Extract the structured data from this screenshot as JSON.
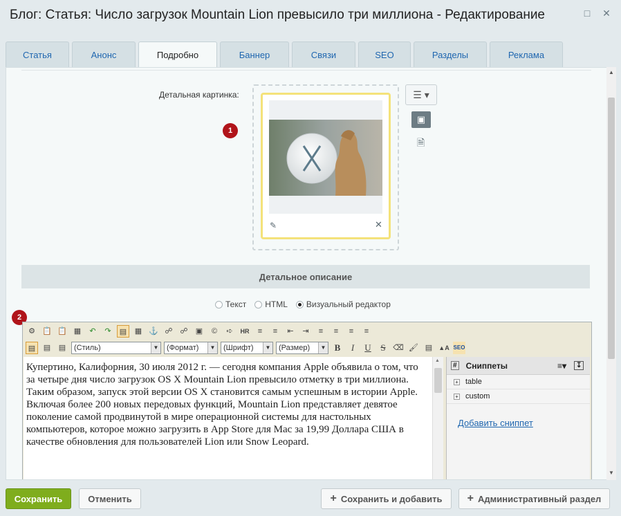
{
  "window": {
    "title": "Блог: Статья: Число загрузок Mountain Lion превысило три миллиона - Редактирование"
  },
  "tabs": [
    {
      "label": "Статья"
    },
    {
      "label": "Анонс"
    },
    {
      "label": "Подробно"
    },
    {
      "label": "Баннер"
    },
    {
      "label": "Связи"
    },
    {
      "label": "SEO"
    },
    {
      "label": "Разделы"
    },
    {
      "label": "Реклама"
    }
  ],
  "detail_image": {
    "label": "Детальная картинка:",
    "badge": "1"
  },
  "detail_description": {
    "heading": "Детальное описание",
    "badge": "2"
  },
  "mode": {
    "options": [
      "Текст",
      "HTML",
      "Визуальный редактор"
    ],
    "selected": "Визуальный редактор"
  },
  "toolbar": {
    "style_select": "(Стиль)",
    "format_select": "(Формат)",
    "font_select": "(Шрифт)",
    "size_select": "(Размер)",
    "bold": "B",
    "italic": "I",
    "underline": "U",
    "strike": "S",
    "hr": "HR",
    "seo": "SEO"
  },
  "content": {
    "paragraph1": "Купертино, Калифорния, 30 июля 2012 г. — сегодня компания Apple объявила о том, что за четыре дня число загрузок OS X Mountain Lion превысило отметку в три миллиона.",
    "paragraph2": "Таким образом, запуск этой версии OS X становится самым успешным в истории Apple. Включая более 200 новых передовых функций, Mountain Lion представляет девятое поколение самой продвинутой в мире операционной системы для настольных компьютеров, которое можно загрузить в App Store для Mac за 19,99 Доллара США в качестве обновления для пользователей Lion или Snow Leopard."
  },
  "snippets": {
    "title": "Сниппеты",
    "items": [
      {
        "label": "table"
      },
      {
        "label": "custom"
      }
    ],
    "add_link": "Добавить сниппет"
  },
  "footer": {
    "save": "Сохранить",
    "cancel": "Отменить",
    "save_add": "Сохранить и добавить",
    "admin": "Административный раздел"
  },
  "colors": {
    "primary": "#7fad1d",
    "link": "#2067b0",
    "badge": "#b0141a"
  }
}
